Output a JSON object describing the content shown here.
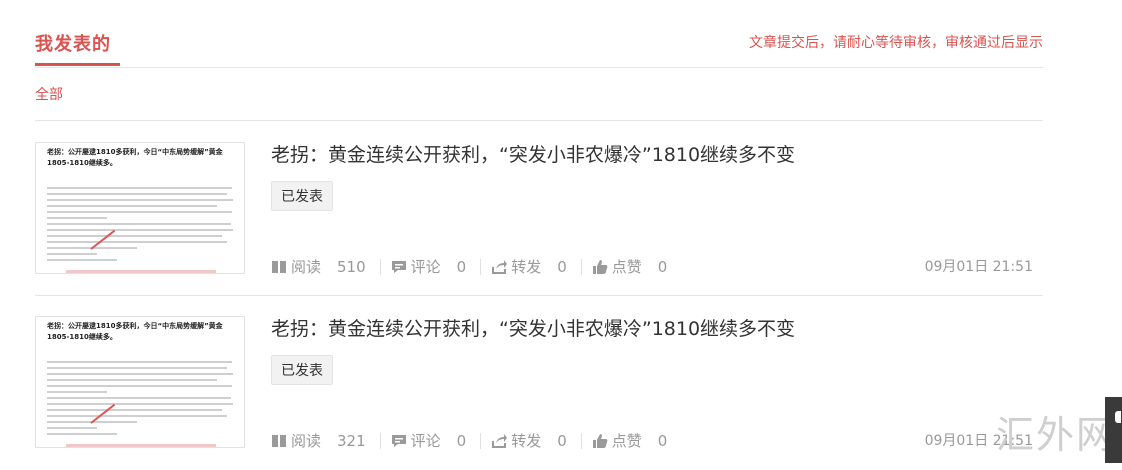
{
  "header": {
    "tab_label": "我发表的",
    "notice": "文章提交后，请耐心等待审核，审核通过后显示"
  },
  "filter": {
    "all_label": "全部"
  },
  "articles": [
    {
      "title": "老拐：黄金连续公开获利，“突发小非农爆冷”1810继续多不变",
      "status": "已发表",
      "thumb_title": "老拐：公开屡逮1810多获利，今日“中东局势缓解”黄金1805-1810继续多。",
      "stats": {
        "read_label": "阅读",
        "read_count": "510",
        "comment_label": "评论",
        "comment_count": "0",
        "share_label": "转发",
        "share_count": "0",
        "like_label": "点赞",
        "like_count": "0"
      },
      "date": "09月01日 21:51"
    },
    {
      "title": "老拐：黄金连续公开获利，“突发小非农爆冷”1810继续多不变",
      "status": "已发表",
      "thumb_title": "老拐：公开屡逮1810多获利，今日“中东局势缓解”黄金1805-1810继续多。",
      "stats": {
        "read_label": "阅读",
        "read_count": "321",
        "comment_label": "评论",
        "comment_count": "0",
        "share_label": "转发",
        "share_count": "0",
        "like_label": "点赞",
        "like_count": "0"
      },
      "date": "09月01日 21:51"
    }
  ],
  "watermark": "汇外网",
  "colors": {
    "accent": "#d9534f",
    "muted": "#999999",
    "divider": "#e5e5e5"
  },
  "icons": [
    "book-icon",
    "comment-icon",
    "share-icon",
    "thumbs-up-icon"
  ]
}
